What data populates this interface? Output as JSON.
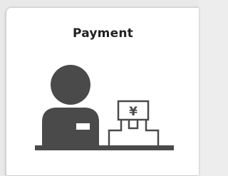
{
  "tile": {
    "title": "Payment",
    "icon": "cashier-payment-icon",
    "register_symbol": "¥"
  },
  "colors": {
    "icon_fill": "#4a4a4a",
    "background": "#e9e9e9",
    "tile_background": "#ffffff",
    "title_text": "#222222"
  }
}
